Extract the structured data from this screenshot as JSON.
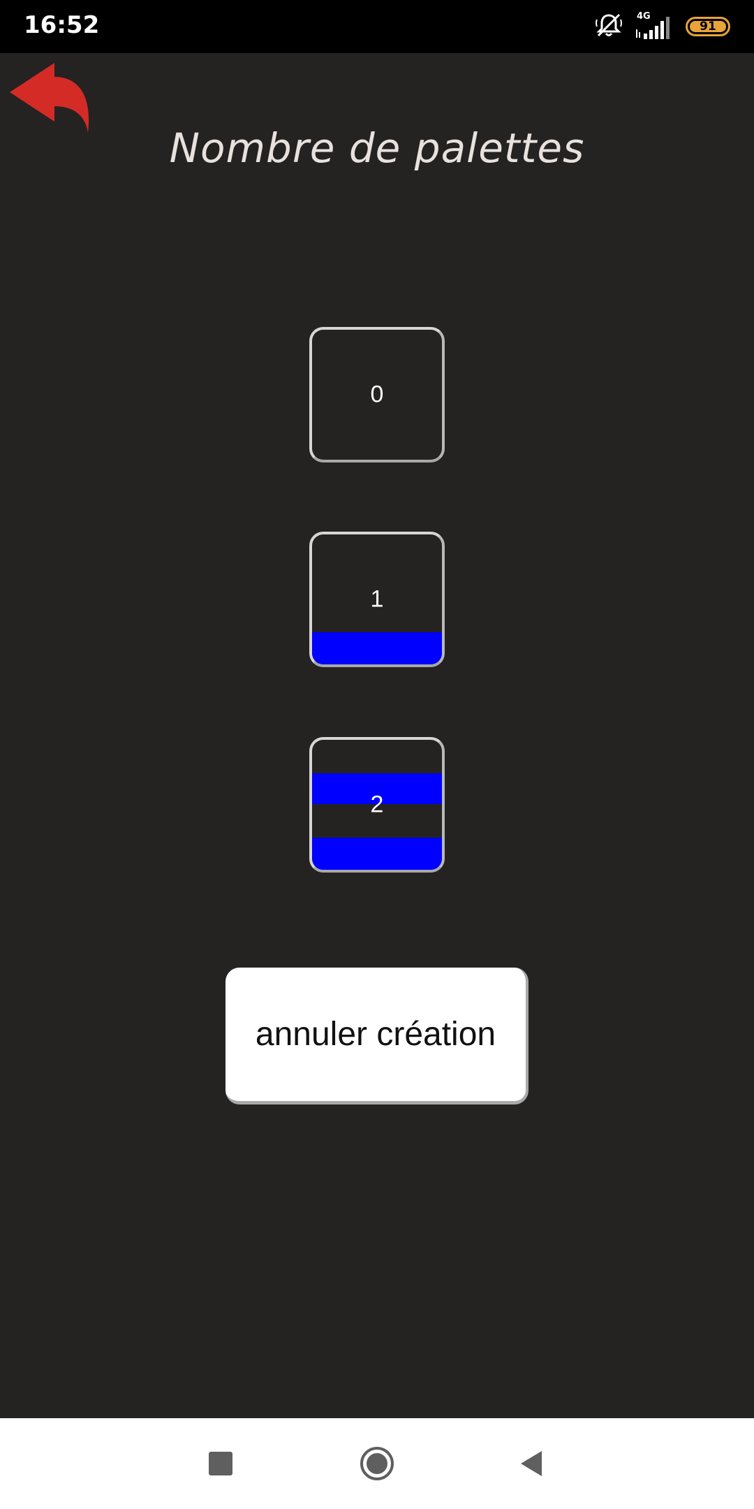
{
  "status_bar": {
    "time": "16:52",
    "network_type": "4G",
    "battery_level": "91",
    "icons": [
      "mute-alarm-icon",
      "signal-icon",
      "battery-icon"
    ],
    "battery_color": "#e7a43a"
  },
  "header": {
    "title": "Nombre de palettes",
    "back_icon": "undo-arrow-icon",
    "back_icon_color": "#d42b27"
  },
  "palette_options": [
    {
      "label": "0",
      "bars": 0
    },
    {
      "label": "1",
      "bars": 1
    },
    {
      "label": "2",
      "bars": 2
    }
  ],
  "palette_bar_color": "#0000ff",
  "actions": {
    "cancel_label": "annuler création"
  },
  "nav_bar": {
    "items": [
      "recent-apps-icon",
      "home-icon",
      "back-icon"
    ]
  },
  "colors": {
    "background": "#252222",
    "title_color": "#e8e2de"
  }
}
